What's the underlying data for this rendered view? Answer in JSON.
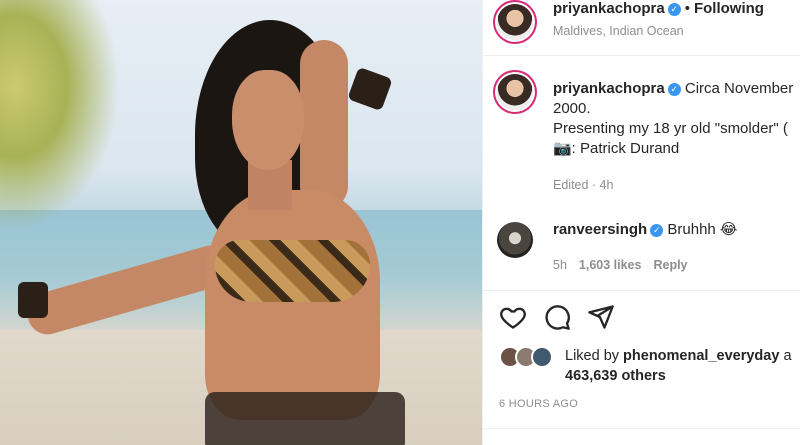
{
  "post": {
    "username": "priyankachopra",
    "verified_symbol": "✓",
    "separator": "•",
    "follow_status": "Following",
    "location": "Maldives, Indian Ocean"
  },
  "caption": {
    "username": "priyankachopra",
    "text": "Circa November 2000.\nPresenting my 18 yr old \"smolder\" (\n📷: Patrick Durand",
    "meta": "Edited · 4h"
  },
  "comment": {
    "username": "ranveersingh",
    "text": "Bruhhh 😂",
    "time": "5h",
    "likes": "1,603 likes",
    "reply": "Reply"
  },
  "actions": {
    "like_icon": "heart-icon",
    "comment_icon": "comment-icon",
    "share_icon": "share-icon"
  },
  "likes": {
    "liked_by_prefix": "Liked by",
    "liked_by_user": "phenomenal_everyday",
    "liked_by_suffix": "a",
    "others": "463,639 others"
  },
  "timestamp": "6 HOURS AGO",
  "colors": {
    "verified_blue": "#3897f0",
    "story_ring": "#d62976",
    "muted_text": "#8e8e8e"
  }
}
